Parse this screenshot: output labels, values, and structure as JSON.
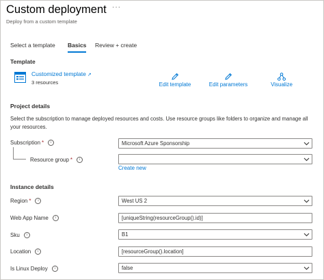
{
  "header": {
    "title": "Custom deployment",
    "ellipsis": "···",
    "subtitle": "Deploy from a custom template"
  },
  "tabs": [
    {
      "label": "Select a template",
      "active": false
    },
    {
      "label": "Basics",
      "active": true
    },
    {
      "label": "Review + create",
      "active": false
    }
  ],
  "template": {
    "heading": "Template",
    "name": "Customized template",
    "resources": "3 resources",
    "actions": {
      "edit_template": "Edit template",
      "edit_parameters": "Edit parameters",
      "visualize": "Visualize"
    }
  },
  "project": {
    "heading": "Project details",
    "description": "Select the subscription to manage deployed resources and costs. Use resource groups like folders to organize and manage all your resources.",
    "subscription": {
      "label": "Subscription",
      "required": "*",
      "value": "Microsoft Azure Sponsorship"
    },
    "resource_group": {
      "label": "Resource group",
      "required": "*",
      "value": ""
    },
    "create_new": "Create new"
  },
  "instance": {
    "heading": "Instance details",
    "region": {
      "label": "Region",
      "required": "*",
      "value": "West US 2"
    },
    "web_app_name": {
      "label": "Web App Name",
      "value": "[uniqueString(resourceGroup().id)]"
    },
    "sku": {
      "label": "Sku",
      "value": "B1"
    },
    "location": {
      "label": "Location",
      "value": "[resourceGroup().location]"
    },
    "is_linux": {
      "label": "Is Linux Deploy",
      "value": "false"
    }
  },
  "colors": {
    "accent": "#0078d4",
    "required": "#a4262c",
    "border": "#8a8886"
  }
}
